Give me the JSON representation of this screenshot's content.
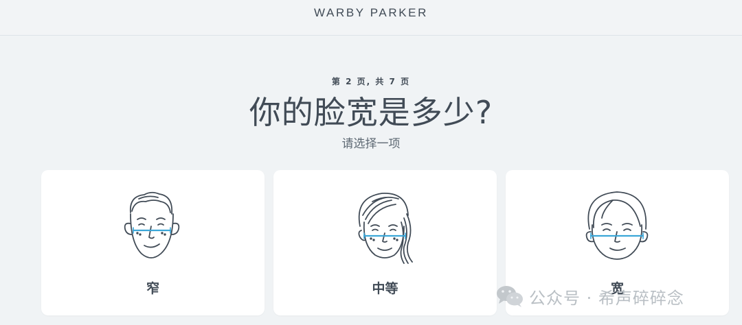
{
  "header": {
    "brand": "WARBY PARKER"
  },
  "quiz": {
    "progress": "第 2 页, 共 7 页",
    "question": "你的脸宽是多少?",
    "instruction": "请选择一项"
  },
  "options": [
    {
      "label": "窄",
      "icon": "narrow-face-icon"
    },
    {
      "label": "中等",
      "icon": "medium-face-icon"
    },
    {
      "label": "宽",
      "icon": "wide-face-icon"
    }
  ],
  "watermark": {
    "text": "公众号 · 希声碎碎念",
    "icon": "wechat-icon"
  },
  "colors": {
    "background": "#f0f3f5",
    "card": "#ffffff",
    "text": "#414b56",
    "measure_line": "#3aa6d8"
  }
}
